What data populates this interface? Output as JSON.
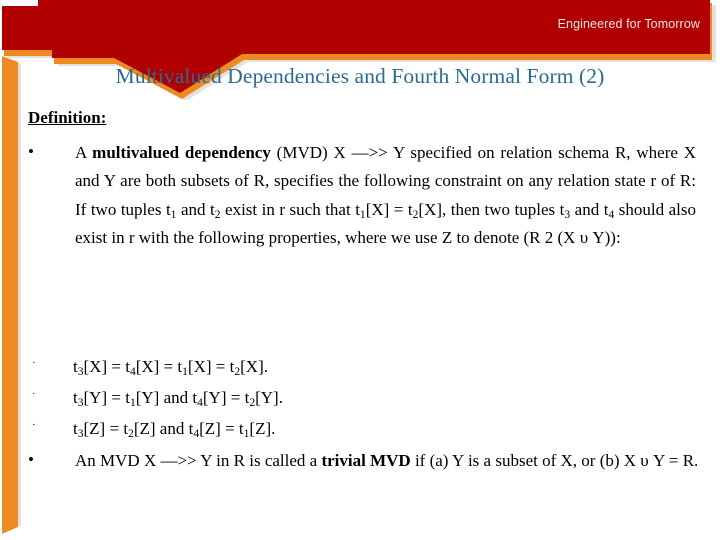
{
  "header": {
    "tagline": "Engineered for Tomorrow",
    "banner_color": "#B00000",
    "accent_color": "#ED8B22",
    "title_color": "#2A6B92"
  },
  "slide": {
    "title": "Multivalued Dependencies and Fourth Normal Form (2)",
    "definition_heading": "Definition:"
  },
  "body": {
    "bullets": [
      {
        "marker": "•",
        "segments": [
          {
            "text": "A ",
            "bold": false
          },
          {
            "text": "multivalued dependency",
            "bold": true
          },
          {
            "text": " (MVD) X —>> Y specified on relation schema R, where X and Y are both subsets of R, specifies the following constraint on any relation state r of R: If two tuples t",
            "bold": false
          },
          {
            "text": "1",
            "sub": true
          },
          {
            "text": " and t",
            "bold": false
          },
          {
            "text": "2",
            "sub": true
          },
          {
            "text": " exist in r such that t",
            "bold": false
          },
          {
            "text": "1",
            "sub": true
          },
          {
            "text": "[X] = t",
            "bold": false
          },
          {
            "text": "2",
            "sub": true
          },
          {
            "text": "[X], then two tuples t",
            "bold": false
          },
          {
            "text": "3",
            "sub": true
          },
          {
            "text": " and t",
            "bold": false
          },
          {
            "text": "4",
            "sub": true
          },
          {
            "text": " should also exist in r with the following properties, where we use Z to denote (R 2 (X υ Y)):",
            "bold": false
          }
        ],
        "plain": "A multivalued dependency (MVD) X —>> Y specified on relation schema R, where X and Y are both subsets of R, specifies the following constraint on any relation state r of R: If two tuples t1 and t2 exist in r such that t1[X] = t2[X], then two tuples t3 and t4 should also exist in r with the following properties, where we use Z to denote (R 2 (X υ Y)):"
      }
    ],
    "sub_bullets": [
      {
        "marker": "·",
        "plain": "t3[X] = t4[X] = t1[X] = t2[X]."
      },
      {
        "marker": "·",
        "plain": "t3[Y] = t1[Y] and t4[Y] = t2[Y]."
      },
      {
        "marker": "·",
        "plain": "t3[Z] = t2[Z] and t4[Z] = t1[Z]."
      }
    ],
    "trivial_bullet": {
      "marker": "•",
      "plain": "An MVD X —>> Y in R is called a trivial MVD if (a) Y is a subset of X, or (b) X υ Y = R.",
      "bold_phrase": "trivial MVD"
    }
  }
}
